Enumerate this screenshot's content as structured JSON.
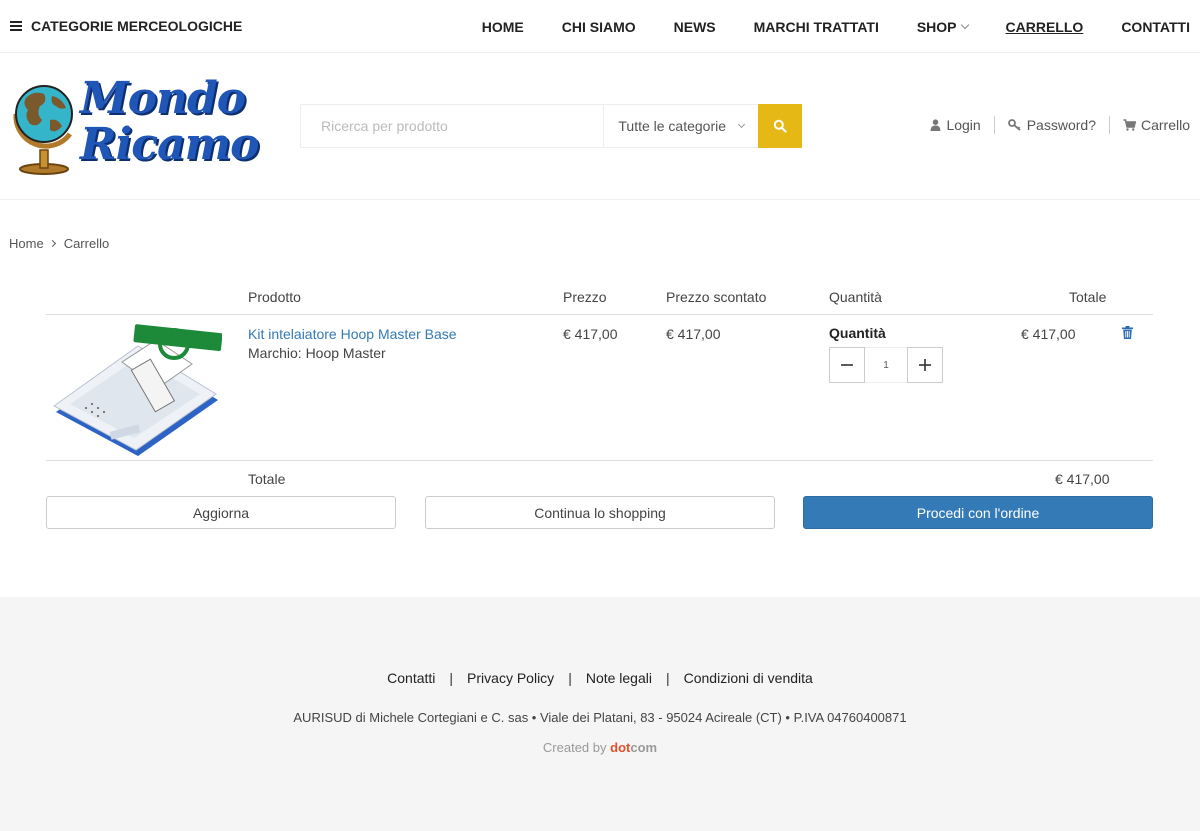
{
  "topnav": {
    "category_menu": "CATEGORIE MERCEOLOGICHE",
    "links": [
      "HOME",
      "CHI SIAMO",
      "NEWS",
      "MARCHI TRATTATI",
      "SHOP",
      "CARRELLO",
      "CONTATTI"
    ]
  },
  "logo": {
    "line1": "Mondo",
    "line2": "Ricamo"
  },
  "search": {
    "placeholder": "Ricerca per prodotto",
    "category": "Tutte le categorie"
  },
  "account": {
    "login": "Login",
    "password": "Password?",
    "cart": "Carrello"
  },
  "breadcrumb": {
    "home": "Home",
    "current": "Carrello"
  },
  "cart": {
    "headers": {
      "product": "Prodotto",
      "price": "Prezzo",
      "discounted": "Prezzo scontato",
      "quantity": "Quantità",
      "total": "Totale"
    },
    "item": {
      "name": "Kit intelaiatore Hoop Master Base",
      "brand": "Marchio: Hoop Master",
      "price": "€ 417,00",
      "discounted": "€ 417,00",
      "quantity_label": "Quantità",
      "quantity": "1",
      "total": "€ 417,00"
    },
    "total_label": "Totale",
    "total_value": "€ 417,00",
    "buttons": {
      "update": "Aggiorna",
      "continue": "Continua lo shopping",
      "checkout": "Procedi con l'ordine"
    }
  },
  "footer": {
    "links": [
      "Contatti",
      "Privacy Policy",
      "Note legali",
      "Condizioni di vendita"
    ],
    "address": "AURISUD di Michele Cortegiani e C. sas • Viale dei Platani, 83 - 95024 Acireale (CT) • P.IVA 04760400871",
    "credit_prefix": "Created by",
    "credit_dot": "dot",
    "credit_com": "com"
  },
  "colors": {
    "accent": "#e5b815",
    "primary": "#337ab7",
    "logo": "#1f56b8"
  }
}
